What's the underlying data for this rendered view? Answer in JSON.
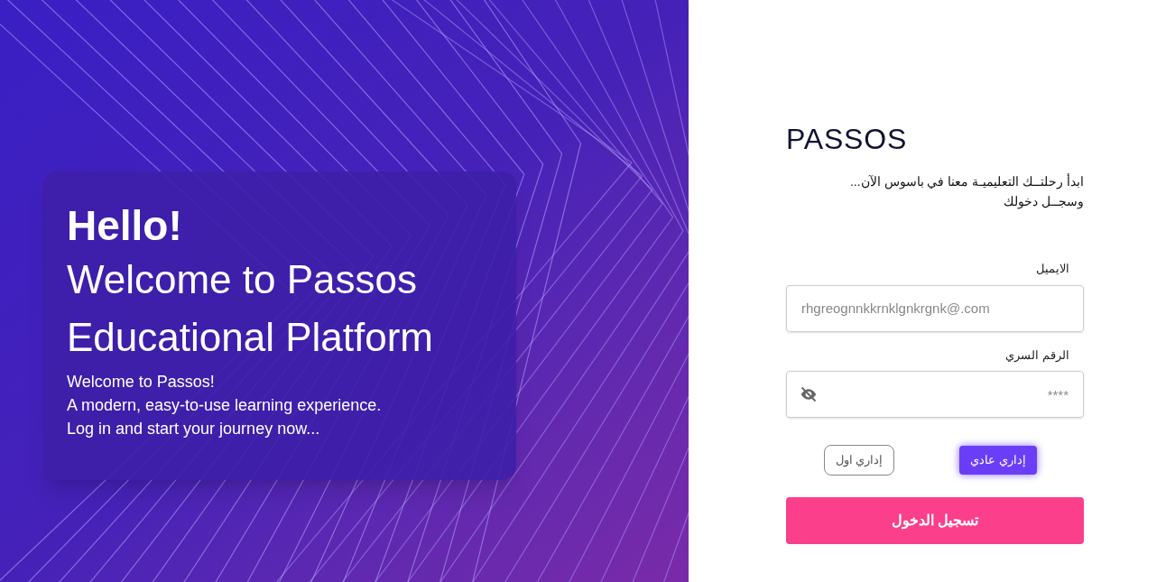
{
  "hero": {
    "heading": "Hello!",
    "title_lines": [
      "Welcome to Passos",
      "Educational Platform"
    ],
    "description_lines": [
      "Welcome to Passos!",
      "A modern, easy-to-use learning experience.",
      "Log in and start your journey now..."
    ]
  },
  "login": {
    "brand": "PASSOS",
    "intro_lines": [
      "ابدأ رحلتــك التعليميـة معنا في باسوس الآن...",
      "وسجــل دخولك"
    ],
    "email": {
      "label": "الايميل",
      "placeholder": "rhgreognnkkrnklgnkrgnk@.com"
    },
    "password": {
      "label": "الرقم السري",
      "placeholder": "****",
      "visible": false
    },
    "roles": [
      {
        "label": "إداري عادي",
        "selected": true
      },
      {
        "label": "إداري اول",
        "selected": false
      }
    ],
    "submit": "تسجيل الدخول"
  }
}
